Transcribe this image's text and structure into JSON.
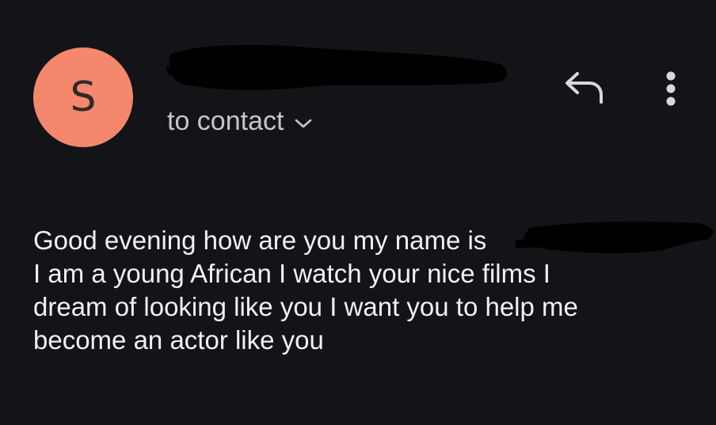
{
  "sender": {
    "avatar_letter": "S",
    "avatar_color": "#f5876c"
  },
  "recipient": {
    "label": "to contact"
  },
  "icons": {
    "reply": "reply-arrow-icon",
    "more": "more-vertical-icon",
    "expand": "chevron-down-icon"
  },
  "message": {
    "lines": [
      "Good evening how are you my name is",
      "I am a young African I watch your nice films I",
      "dream of looking like you I want you to help me",
      "become an actor like you"
    ]
  },
  "colors": {
    "background": "#131418",
    "redaction": "#000000",
    "text": "#f1f1f3",
    "secondary_text": "#c4c6cc"
  }
}
